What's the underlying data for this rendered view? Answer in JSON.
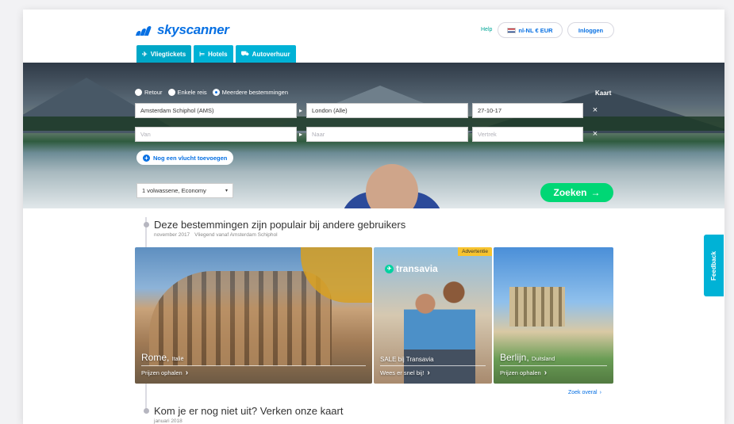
{
  "brand": {
    "name": "skyscanner",
    "color": "#0770e3"
  },
  "header": {
    "help": "Help",
    "locale": "nl-NL € EUR",
    "login": "Inloggen"
  },
  "tabs": [
    {
      "label": "Vliegtickets",
      "icon": "plane-icon",
      "active": true
    },
    {
      "label": "Hotels",
      "icon": "bed-icon",
      "active": false
    },
    {
      "label": "Autoverhuur",
      "icon": "car-icon",
      "active": false
    }
  ],
  "trip_type": {
    "options": [
      "Retour",
      "Enkele reis",
      "Meerdere bestemmingen"
    ],
    "selected": "Meerdere bestemmingen"
  },
  "map_link": "Kaart",
  "legs": [
    {
      "from": "Amsterdam Schiphol (AMS)",
      "to": "London (Alle)",
      "date": "27-10-17"
    },
    {
      "from_placeholder": "Van",
      "to_placeholder": "Naar",
      "date_placeholder": "Vertrek"
    }
  ],
  "add_flight": "Nog een vlucht toevoegen",
  "travellers": "1 volwassene, Economy",
  "search_button": "Zoeken",
  "popular": {
    "title": "Deze bestemmingen zijn populair bij andere gebruikers",
    "month": "november 2017",
    "origin": "Vliegend vanaf Amsterdam Schiphol",
    "cards": [
      {
        "city": "Rome,",
        "country": "Italië",
        "cta": "Prijzen ophalen"
      },
      {
        "badge": "Advertentie",
        "logo": "transavia",
        "headline": "SALE bij Transavia",
        "cta": "Wees er snel bij!"
      },
      {
        "city": "Berlijn,",
        "country": "Duitsland",
        "cta": "Prijzen ophalen"
      }
    ],
    "search_all": "Zoek overal"
  },
  "map_section": {
    "title": "Kom je er nog niet uit? Verken onze kaart",
    "month": "januari 2018"
  },
  "feedback": "Feedback",
  "colors": {
    "accent": "#00b2d6",
    "cta": "#00d775",
    "ad": "#f7c32e"
  }
}
